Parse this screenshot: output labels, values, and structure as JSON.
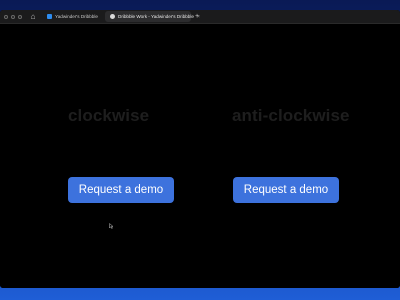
{
  "browser": {
    "tabs": [
      {
        "label": "Yadwinder's Dribbble",
        "active": false
      },
      {
        "label": "Dribbble Work - Yadwinder's Dribbble",
        "active": true
      }
    ],
    "new_tab": "+",
    "close": "×"
  },
  "page": {
    "left_heading": "clockwise",
    "right_heading": "anti-clockwise",
    "left_button": "Request a demo",
    "right_button": "Request a demo"
  },
  "colors": {
    "button": "#3d72dd",
    "heading": "#1e1e1e",
    "background": "#000000"
  }
}
